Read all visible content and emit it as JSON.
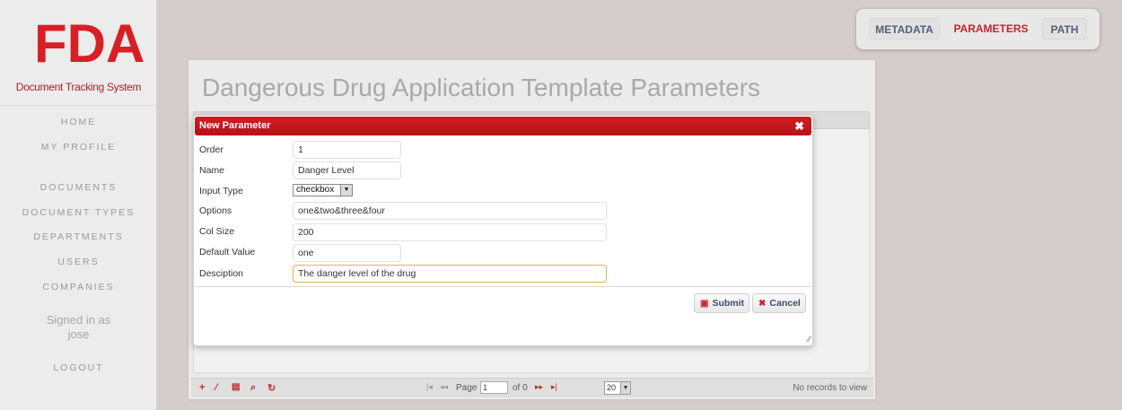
{
  "sidebar": {
    "logo": "FDA",
    "subtitle": "Document Tracking System",
    "nav": [
      "HOME",
      "MY PROFILE",
      "DOCUMENTS",
      "DOCUMENT TYPES",
      "DEPARTMENTS",
      "USERS",
      "COMPANIES"
    ],
    "signed_in_label": "Signed in as",
    "user": "jose",
    "logout": "LOGOUT"
  },
  "tabs": [
    "METADATA",
    "PARAMETERS",
    "PATH"
  ],
  "page": {
    "title": "Dangerous Drug Application Template Parameters"
  },
  "modal": {
    "title": "New Parameter",
    "close_icon": "✖",
    "fields": {
      "order": {
        "label": "Order",
        "value": "1"
      },
      "name": {
        "label": "Name",
        "value": "Danger Level"
      },
      "input_type": {
        "label": "Input Type",
        "value": "checkbox"
      },
      "options": {
        "label": "Options",
        "value": "one&two&three&four"
      },
      "col_size": {
        "label": "Col Size",
        "value": "200"
      },
      "default_value": {
        "label": "Default Value",
        "value": "one"
      },
      "description": {
        "label": "Desciption",
        "value": "The danger level of the drug"
      }
    },
    "submit": "Submit",
    "cancel": "Cancel"
  },
  "pager": {
    "page_label": "Page",
    "page_value": "1",
    "of_label": "of 0",
    "page_size": "20",
    "status": "No records to view"
  },
  "colors": {
    "brand_red": "#d81f26",
    "background": "#d5cccc"
  }
}
